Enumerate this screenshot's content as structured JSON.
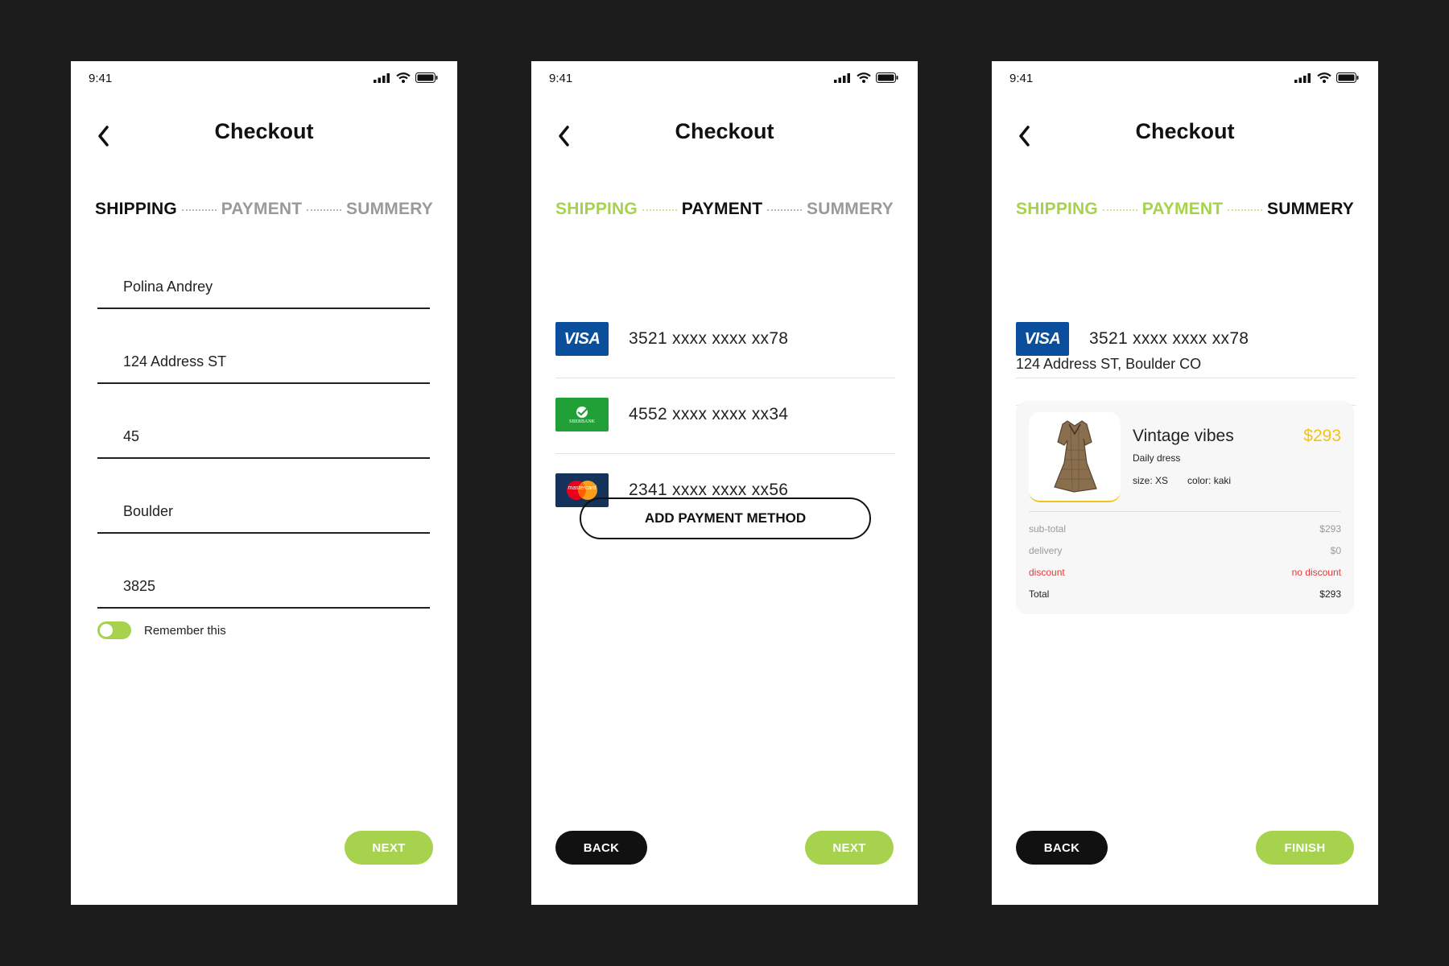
{
  "status_bar": {
    "time": "9:41"
  },
  "screens": [
    {
      "title": "Checkout",
      "steps": [
        "SHIPPING",
        "PAYMENT",
        "SUMMERY"
      ],
      "fields": [
        "Polina Andrey",
        "124 Address ST",
        "45",
        "Boulder",
        "3825"
      ],
      "remember_label": "Remember this",
      "next_label": "NEXT"
    },
    {
      "title": "Checkout",
      "steps": [
        "SHIPPING",
        "PAYMENT",
        "SUMMERY"
      ],
      "cards": [
        {
          "brand": "VISA",
          "icon": "visa-logo",
          "number": "3521 xxxx xxxx xx78"
        },
        {
          "brand": "SBERBANK",
          "icon": "sberbank-logo",
          "number": "4552 xxxx xxxx xx34"
        },
        {
          "brand": "mastercard",
          "icon": "mastercard-logo",
          "number": "2341 xxxx xxxx xx56"
        }
      ],
      "add_method_label": "ADD PAYMENT METHOD",
      "back_label": "BACK",
      "next_label": "NEXT"
    },
    {
      "title": "Checkout",
      "steps": [
        "SHIPPING",
        "PAYMENT",
        "SUMMERY"
      ],
      "card": {
        "brand": "VISA",
        "number": "3521 xxxx xxxx xx78"
      },
      "address": "124 Address ST,  Boulder CO",
      "product": {
        "name": "Vintage vibes",
        "price": "$293",
        "subtitle": "Daily dress",
        "size": "size: XS",
        "color": "color: kaki",
        "image": "dress-image"
      },
      "totals": [
        {
          "label": "sub-total",
          "value": "$293"
        },
        {
          "label": "delivery",
          "value": "$0"
        },
        {
          "label": "discount",
          "value": "no discount"
        },
        {
          "label": "Total",
          "value": "$293"
        }
      ],
      "back_label": "BACK",
      "finish_label": "FINISH"
    }
  ],
  "colors": {
    "accent_green": "#a6d24e",
    "price_yellow": "#f0c419",
    "discount_red": "#e53935",
    "button_black": "#111111",
    "background": "#1c1c1c"
  }
}
